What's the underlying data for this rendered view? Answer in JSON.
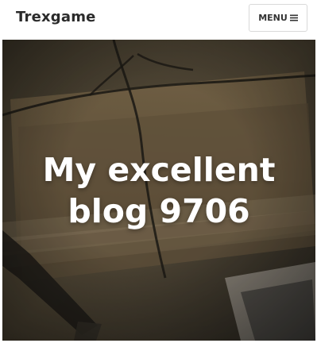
{
  "header": {
    "brand": "Trexgame",
    "menu_label": "MENU"
  },
  "hero": {
    "title_line_1": "My excellent",
    "title_line_2": "blog 9706"
  },
  "colors": {
    "brand_text": "#2b2b2b",
    "hero_overlay": "#3b342b",
    "hero_title": "#ffffff"
  },
  "icons": {
    "menu": "hamburger-icon"
  }
}
